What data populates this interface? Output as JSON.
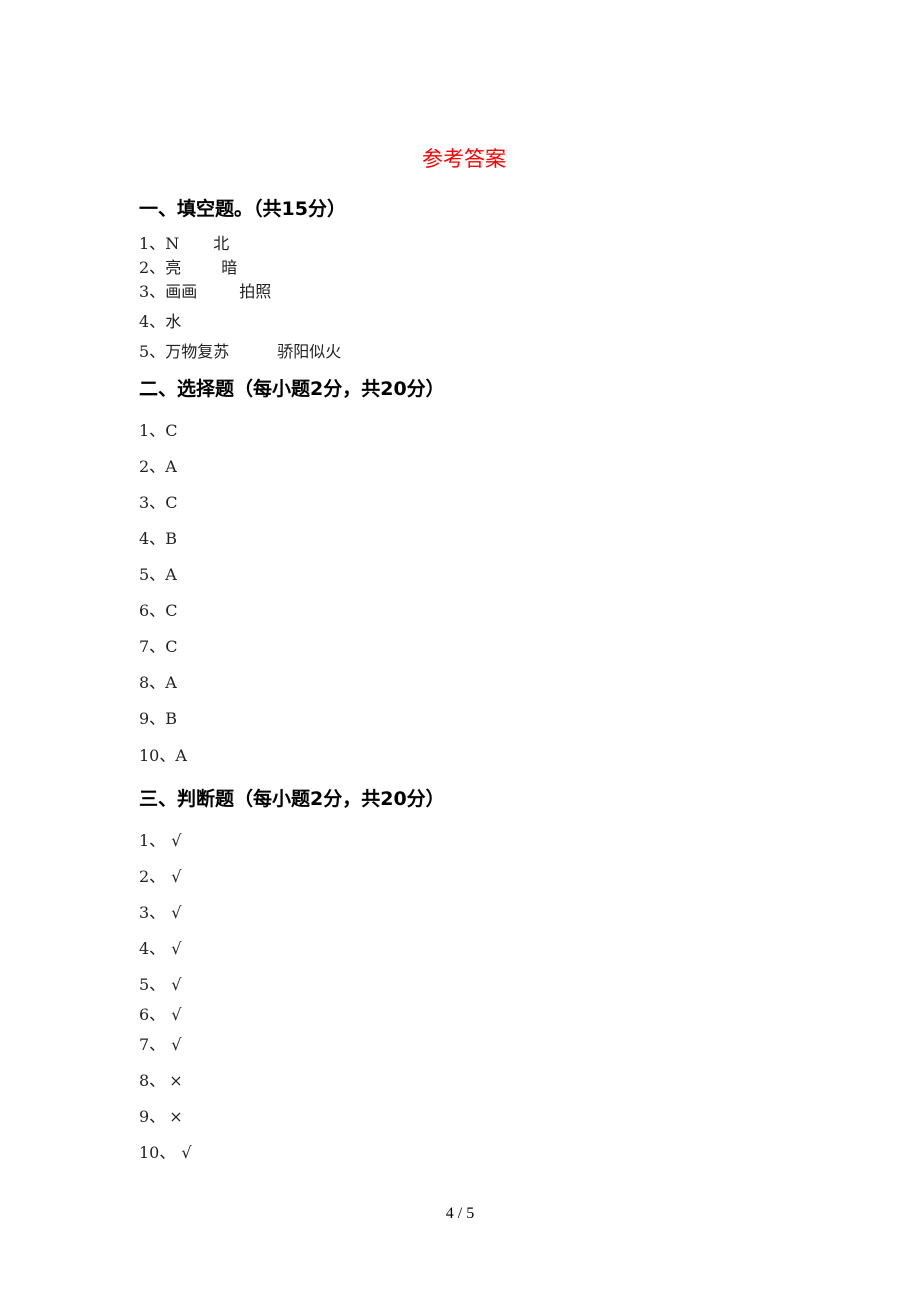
{
  "title": "参考答案",
  "sections": [
    {
      "heading": "一、填空题。（共15分）",
      "items": [
        {
          "num": "1、",
          "answers": [
            "N",
            "北"
          ]
        },
        {
          "num": "2、",
          "answers": [
            "亮",
            "暗"
          ]
        },
        {
          "num": "3、",
          "answers": [
            "画画",
            "拍照"
          ]
        },
        {
          "num": "4、",
          "answers": [
            "水"
          ]
        },
        {
          "num": "5、",
          "answers": [
            "万物复苏",
            "骄阳似火"
          ]
        }
      ]
    },
    {
      "heading": "二、选择题（每小题2分，共20分）",
      "items": [
        {
          "num": "1、",
          "answers": [
            "C"
          ]
        },
        {
          "num": "2、",
          "answers": [
            "A"
          ]
        },
        {
          "num": "3、",
          "answers": [
            "C"
          ]
        },
        {
          "num": "4、",
          "answers": [
            "B"
          ]
        },
        {
          "num": "5、",
          "answers": [
            "A"
          ]
        },
        {
          "num": "6、",
          "answers": [
            "C"
          ]
        },
        {
          "num": "7、",
          "answers": [
            "C"
          ]
        },
        {
          "num": "8、",
          "answers": [
            "A"
          ]
        },
        {
          "num": "9、",
          "answers": [
            "B"
          ]
        },
        {
          "num": "10、",
          "answers": [
            "A"
          ]
        }
      ]
    },
    {
      "heading": "三、判断题（每小题2分，共20分）",
      "items": [
        {
          "num": "1、",
          "answers": [
            "√"
          ]
        },
        {
          "num": "2、",
          "answers": [
            "√"
          ]
        },
        {
          "num": "3、",
          "answers": [
            "√"
          ]
        },
        {
          "num": "4、",
          "answers": [
            "√"
          ]
        },
        {
          "num": "5、",
          "answers": [
            "√"
          ]
        },
        {
          "num": "6、",
          "answers": [
            "√"
          ]
        },
        {
          "num": "7、",
          "answers": [
            "√"
          ]
        },
        {
          "num": "8、",
          "answers": [
            "×"
          ]
        },
        {
          "num": "9、",
          "answers": [
            "×"
          ]
        },
        {
          "num": "10、",
          "answers": [
            "√"
          ]
        }
      ]
    }
  ],
  "page_number": "4 / 5"
}
